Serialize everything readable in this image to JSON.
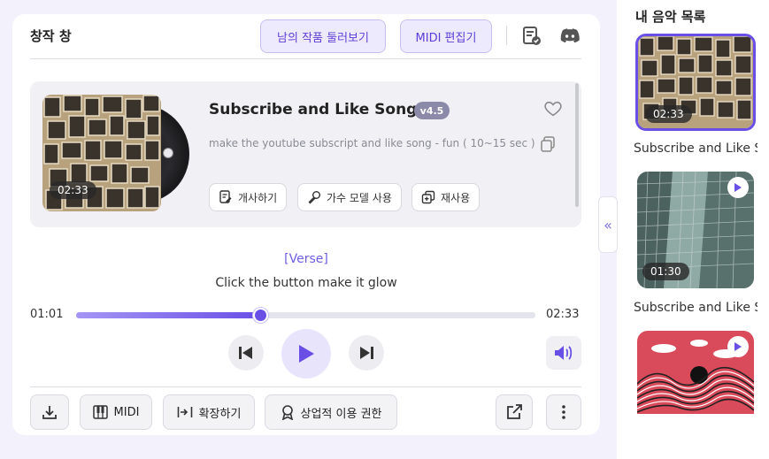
{
  "panel": {
    "title": "창작 창",
    "browse_button": "남의 작품 둘러보기",
    "midi_editor_button": "MIDI 편집기"
  },
  "song": {
    "title": "Subscribe and Like Song",
    "version": "v4.5",
    "prompt": "make the youtube subscript and like song - fun ( 10~15 sec )",
    "duration": "02:33",
    "actions": {
      "lyrics": "개사하기",
      "singer_model": "가수 모델 사용",
      "reuse": "재사용"
    }
  },
  "lyrics": {
    "section": "[Verse]",
    "line": "Click the button make it glow"
  },
  "player": {
    "current_time": "01:01",
    "total_time": "02:33",
    "progress": 0.4
  },
  "footer": {
    "midi": "MIDI",
    "extend": "확장하기",
    "commercial": "상업적 이용 권한"
  },
  "sidebar": {
    "title": "내 음악 목록",
    "items": [
      {
        "duration": "02:33",
        "label": "Subscribe and Like Song"
      },
      {
        "duration": "01:30",
        "label": "Subscribe and Like Song"
      },
      {
        "duration": "",
        "label": ""
      }
    ]
  },
  "colors": {
    "accent": "#6a4fe6",
    "accent_light": "#eeeafd",
    "background": "#f3f2fc"
  }
}
